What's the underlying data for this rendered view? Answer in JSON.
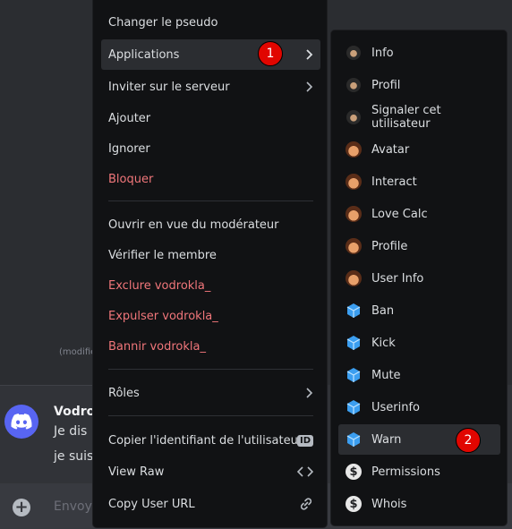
{
  "background": {
    "edited_label": "(modifié",
    "message": {
      "author": "Vodrok",
      "line1": "Je dis",
      "line2": "je suis"
    },
    "composer_placeholder": "Envoye"
  },
  "menu": {
    "items": [
      {
        "label": "Changer le pseudo"
      },
      {
        "label": "Applications"
      },
      {
        "label": "Inviter sur le serveur"
      },
      {
        "label": "Ajouter"
      },
      {
        "label": "Ignorer"
      },
      {
        "label": "Bloquer"
      },
      {
        "label": "Ouvrir en vue du modérateur"
      },
      {
        "label": "Vérifier le membre"
      },
      {
        "label": "Exclure vodrokla_"
      },
      {
        "label": "Expulser vodrokla_"
      },
      {
        "label": "Bannir vodrokla_"
      },
      {
        "label": "Rôles"
      },
      {
        "label": "Copier l'identifiant de l'utilisateur",
        "tag": "ID"
      },
      {
        "label": "View Raw"
      },
      {
        "label": "Copy User URL"
      }
    ],
    "badge": "1"
  },
  "submenu": {
    "items": [
      {
        "label": "Info",
        "icon": "dark-avatar-icon"
      },
      {
        "label": "Profil",
        "icon": "dark-avatar-icon"
      },
      {
        "label": "Signaler cet utilisateur",
        "icon": "dark-avatar-icon"
      },
      {
        "label": "Avatar",
        "icon": "anime-avatar-icon"
      },
      {
        "label": "Interact",
        "icon": "anime-avatar-icon"
      },
      {
        "label": "Love Calc",
        "icon": "anime-avatar-icon"
      },
      {
        "label": "Profile",
        "icon": "anime-avatar-icon"
      },
      {
        "label": "User Info",
        "icon": "anime-avatar-icon"
      },
      {
        "label": "Ban",
        "icon": "blue-cube-icon"
      },
      {
        "label": "Kick",
        "icon": "blue-cube-icon"
      },
      {
        "label": "Mute",
        "icon": "blue-cube-icon"
      },
      {
        "label": "Userinfo",
        "icon": "blue-cube-icon"
      },
      {
        "label": "Warn",
        "icon": "blue-cube-icon"
      },
      {
        "label": "Permissions",
        "icon": "s-logo-icon"
      },
      {
        "label": "Whois",
        "icon": "s-logo-icon"
      }
    ],
    "badge": "2"
  },
  "colors": {
    "danger": "#f0767a",
    "badge": "#e10600",
    "menu_bg": "#111214",
    "hover_bg": "#2b2d31"
  }
}
